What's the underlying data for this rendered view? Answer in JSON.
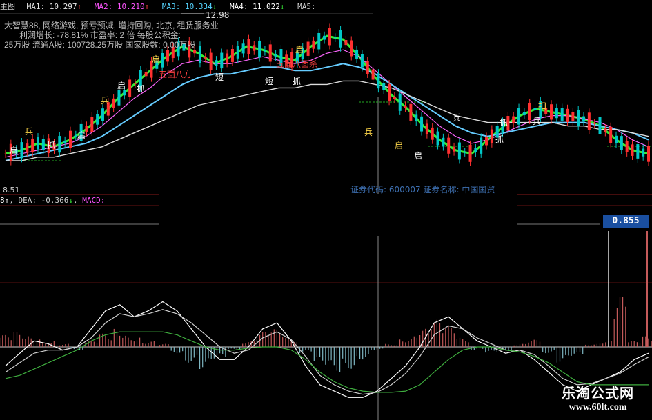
{
  "header": {
    "title_fragment": "主图",
    "ma": [
      {
        "label": "MA1:",
        "value": "10.297",
        "arrow": "↑",
        "color": "#e6e6e6"
      },
      {
        "label": "MA2:",
        "value": "10.210",
        "arrow": "↑",
        "color": "#ff55ff"
      },
      {
        "label": "MA3:",
        "value": "10.334",
        "arrow": "↓",
        "color": "#55d4ff"
      },
      {
        "label": "MA4:",
        "value": "11.022",
        "arrow": "↓",
        "color": "#ffffff"
      },
      {
        "label": "MA5:",
        "value": "",
        "arrow": "",
        "color": "#cccccc"
      }
    ]
  },
  "info": {
    "line1": "大智慧88, 网络游戏, 预亏预减, 增持回购, 北京, 租赁服务业",
    "line2": "利润增长: -78.81%    市盈率: 2     倍    每股公积金:",
    "line3": "25万股   流通A股: 100728.25万股   国家股数: 0.00万股"
  },
  "annotations": {
    "high_price": "12.98",
    "low_price": "8.51",
    "signals": [
      "启",
      "兵",
      "抓",
      "短",
      "乐",
      "扣",
      "五面八方",
      "五面八面杀"
    ],
    "stock_line": "证券代码: 600007  证券名称: 中国国贸"
  },
  "macd_header": {
    "dif_tail": "8↑",
    "dea_label": "DEA:",
    "dea_value": "-0.366",
    "dea_arrow": "↓",
    "macd_label": "MACD:"
  },
  "value_tag": "0.855",
  "watermark": {
    "title": "乐淘公式网",
    "url": "www.60lt.com"
  },
  "colors": {
    "up": "#ff3030",
    "down": "#00c8c8",
    "green_ribbon": "#33ee33",
    "macd_pos": "#c45a5a",
    "macd_neg": "#7fb8c4",
    "dif": "#ffffff",
    "dea": "#cfcfcf",
    "slow": "#3fae3f"
  },
  "chart_data": [
    {
      "type": "candlestick",
      "title": "",
      "price_marks": {
        "high": 12.98,
        "low": 8.51
      },
      "ylim": [
        8.3,
        13.2
      ],
      "series": [
        {
          "name": "MA1",
          "values": [
            9.2,
            9.3,
            9.5,
            9.4,
            9.6,
            9.9,
            10.3,
            10.8,
            11.2,
            11.6,
            12.0,
            12.3,
            12.1,
            11.8,
            12.0,
            12.3,
            12.2,
            12.0,
            11.9,
            12.3,
            12.6,
            12.5,
            12.0,
            11.4,
            10.9,
            10.5,
            10.0,
            9.6,
            9.3,
            9.2,
            9.6,
            10.0,
            10.3,
            10.5,
            10.4,
            10.3,
            10.2,
            10.0,
            9.6,
            9.3,
            9.2
          ]
        },
        {
          "name": "MA2",
          "values": [
            9.1,
            9.2,
            9.3,
            9.4,
            9.5,
            9.7,
            10.0,
            10.4,
            10.8,
            11.1,
            11.5,
            11.8,
            11.9,
            11.8,
            11.8,
            11.9,
            12.0,
            11.9,
            11.8,
            11.9,
            12.1,
            12.2,
            12.0,
            11.6,
            11.2,
            10.8,
            10.4,
            10.0,
            9.7,
            9.5,
            9.6,
            9.8,
            10.0,
            10.2,
            10.3,
            10.3,
            10.2,
            10.1,
            9.9,
            9.6,
            9.4
          ]
        },
        {
          "name": "MA3",
          "values": [
            9.0,
            9.1,
            9.2,
            9.3,
            9.4,
            9.5,
            9.7,
            10.0,
            10.3,
            10.6,
            10.9,
            11.2,
            11.4,
            11.5,
            11.5,
            11.6,
            11.7,
            11.7,
            11.6,
            11.6,
            11.7,
            11.8,
            11.7,
            11.5,
            11.2,
            10.9,
            10.6,
            10.3,
            10.0,
            9.8,
            9.7,
            9.8,
            9.9,
            10.0,
            10.1,
            10.1,
            10.1,
            10.0,
            9.9,
            9.8,
            9.6
          ]
        },
        {
          "name": "MA4",
          "values": [
            9.0,
            9.0,
            9.1,
            9.1,
            9.2,
            9.3,
            9.4,
            9.6,
            9.8,
            10.0,
            10.2,
            10.4,
            10.6,
            10.7,
            10.8,
            10.9,
            11.0,
            11.1,
            11.1,
            11.2,
            11.2,
            11.3,
            11.3,
            11.2,
            11.1,
            10.9,
            10.7,
            10.5,
            10.3,
            10.2,
            10.1,
            10.1,
            10.1,
            10.1,
            10.1,
            10.0,
            10.0,
            9.9,
            9.9,
            9.8,
            9.7
          ]
        }
      ]
    },
    {
      "type": "bar",
      "title": "",
      "series": [
        {
          "name": "MACD",
          "values": [
            0.2,
            0.25,
            0.18,
            0.1,
            0.05,
            -0.05,
            0.1,
            0.22,
            0.3,
            0.18,
            0.1,
            0.05,
            -0.1,
            -0.25,
            -0.35,
            -0.2,
            -0.05,
            0.1,
            0.25,
            0.3,
            0.15,
            -0.1,
            -0.3,
            -0.4,
            -0.35,
            -0.2,
            -0.05,
            0.05,
            0.15,
            0.3,
            0.45,
            0.35,
            0.15,
            -0.05,
            -0.1,
            -0.08,
            0.05,
            0.12,
            -0.1,
            -0.25,
            -0.15,
            0.05,
            0.1,
            0.855,
            0.1,
            0.18
          ]
        },
        {
          "name": "DIF",
          "values": [
            -0.3,
            -0.1,
            0.1,
            0.05,
            -0.05,
            0.0,
            0.3,
            0.6,
            0.7,
            0.5,
            0.6,
            0.75,
            0.6,
            0.3,
            0.0,
            -0.2,
            -0.2,
            0.0,
            0.3,
            0.4,
            0.1,
            -0.3,
            -0.6,
            -0.7,
            -0.8,
            -0.8,
            -0.7,
            -0.5,
            -0.3,
            0.0,
            0.4,
            0.5,
            0.3,
            0.1,
            0.0,
            -0.1,
            -0.05,
            -0.2,
            -0.4,
            -0.6,
            -0.7,
            -0.6,
            -0.5,
            -0.4,
            -0.2,
            -0.1
          ]
        },
        {
          "name": "DEA",
          "values": [
            -0.4,
            -0.25,
            -0.1,
            -0.05,
            -0.05,
            0.0,
            0.15,
            0.4,
            0.55,
            0.5,
            0.55,
            0.62,
            0.55,
            0.4,
            0.2,
            0.0,
            -0.1,
            -0.05,
            0.15,
            0.25,
            0.12,
            -0.15,
            -0.45,
            -0.6,
            -0.7,
            -0.75,
            -0.72,
            -0.6,
            -0.42,
            -0.15,
            0.2,
            0.35,
            0.3,
            0.15,
            0.05,
            -0.05,
            -0.05,
            -0.12,
            -0.3,
            -0.5,
            -0.6,
            -0.58,
            -0.5,
            -0.42,
            -0.28,
            -0.16
          ]
        },
        {
          "name": "SLOW",
          "values": [
            -0.5,
            -0.45,
            -0.35,
            -0.25,
            -0.15,
            -0.05,
            0.1,
            0.2,
            0.25,
            0.25,
            0.25,
            0.25,
            0.2,
            0.1,
            0.0,
            -0.05,
            -0.05,
            -0.02,
            0.0,
            0.0,
            -0.05,
            -0.2,
            -0.4,
            -0.55,
            -0.65,
            -0.7,
            -0.72,
            -0.72,
            -0.7,
            -0.6,
            -0.4,
            -0.2,
            -0.05,
            0.0,
            0.0,
            -0.05,
            -0.08,
            -0.15,
            -0.25,
            -0.4,
            -0.55,
            -0.6,
            -0.6,
            -0.6,
            -0.6,
            -0.6
          ]
        }
      ],
      "ylim": [
        -0.95,
        0.95
      ]
    }
  ]
}
